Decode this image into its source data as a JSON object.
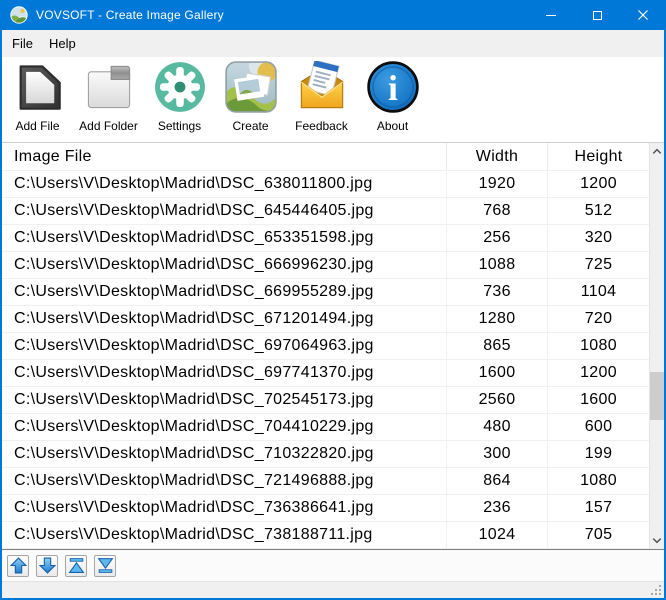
{
  "window": {
    "title": "VOVSOFT - Create Image Gallery",
    "controls": [
      {
        "name": "minimize",
        "icon": "minimize-icon"
      },
      {
        "name": "maximize",
        "icon": "maximize-icon"
      },
      {
        "name": "close",
        "icon": "close-icon"
      }
    ]
  },
  "menu": {
    "items": [
      {
        "label": "File"
      },
      {
        "label": "Help"
      }
    ]
  },
  "toolbar": {
    "buttons": [
      {
        "label": "Add File",
        "icon": "document-icon"
      },
      {
        "label": "Add Folder",
        "icon": "folder-icon"
      },
      {
        "label": "Settings",
        "icon": "gear-icon"
      },
      {
        "label": "Create",
        "icon": "gallery-icon"
      },
      {
        "label": "Feedback",
        "icon": "envelope-icon"
      },
      {
        "label": "About",
        "icon": "info-icon"
      }
    ]
  },
  "table": {
    "headers": [
      "Image File",
      "Width",
      "Height"
    ],
    "rows": [
      {
        "path": "C:\\Users\\V\\Desktop\\Madrid\\DSC_638011800.jpg",
        "width": "1920",
        "height": "1200"
      },
      {
        "path": "C:\\Users\\V\\Desktop\\Madrid\\DSC_645446405.jpg",
        "width": "768",
        "height": "512"
      },
      {
        "path": "C:\\Users\\V\\Desktop\\Madrid\\DSC_653351598.jpg",
        "width": "256",
        "height": "320"
      },
      {
        "path": "C:\\Users\\V\\Desktop\\Madrid\\DSC_666996230.jpg",
        "width": "1088",
        "height": "725"
      },
      {
        "path": "C:\\Users\\V\\Desktop\\Madrid\\DSC_669955289.jpg",
        "width": "736",
        "height": "1104"
      },
      {
        "path": "C:\\Users\\V\\Desktop\\Madrid\\DSC_671201494.jpg",
        "width": "1280",
        "height": "720"
      },
      {
        "path": "C:\\Users\\V\\Desktop\\Madrid\\DSC_697064963.jpg",
        "width": "865",
        "height": "1080"
      },
      {
        "path": "C:\\Users\\V\\Desktop\\Madrid\\DSC_697741370.jpg",
        "width": "1600",
        "height": "1200"
      },
      {
        "path": "C:\\Users\\V\\Desktop\\Madrid\\DSC_702545173.jpg",
        "width": "2560",
        "height": "1600"
      },
      {
        "path": "C:\\Users\\V\\Desktop\\Madrid\\DSC_704410229.jpg",
        "width": "480",
        "height": "600"
      },
      {
        "path": "C:\\Users\\V\\Desktop\\Madrid\\DSC_710322820.jpg",
        "width": "300",
        "height": "199"
      },
      {
        "path": "C:\\Users\\V\\Desktop\\Madrid\\DSC_721496888.jpg",
        "width": "864",
        "height": "1080"
      },
      {
        "path": "C:\\Users\\V\\Desktop\\Madrid\\DSC_736386641.jpg",
        "width": "236",
        "height": "157"
      },
      {
        "path": "C:\\Users\\V\\Desktop\\Madrid\\DSC_738188711.jpg",
        "width": "1024",
        "height": "705"
      }
    ]
  },
  "nav": {
    "buttons": [
      {
        "icon": "arrow-up-icon"
      },
      {
        "icon": "arrow-down-icon"
      },
      {
        "icon": "move-top-icon"
      },
      {
        "icon": "move-bottom-icon"
      }
    ]
  },
  "colors": {
    "accent": "#0078d7",
    "menubar_bg": "#f0f0f0",
    "settings_teal": "#57b99f",
    "about_blue": "#1878c8",
    "feedback_gold": "#f3ab1e",
    "nav_arrow_blue": "#1e7ad1"
  }
}
